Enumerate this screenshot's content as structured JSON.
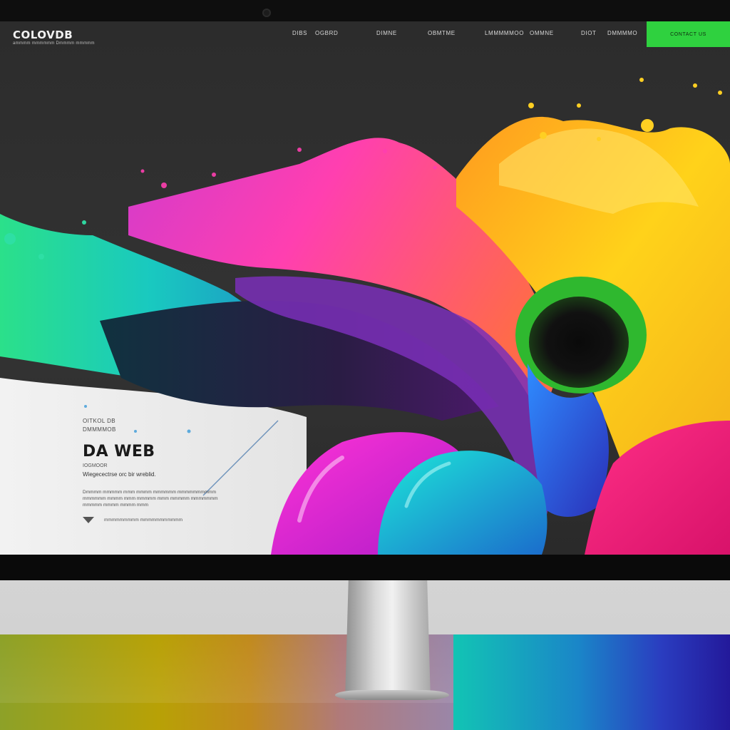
{
  "site": {
    "logo": "COLOVDB",
    "logo_sub": "ammmm mmmmmm Dmmmm mmmmm"
  },
  "nav": {
    "items": [
      "DIBS",
      "OGBRD",
      "DIMNE",
      "OBMTME",
      "LMMMMMOO",
      "OMMNE",
      "DIOT",
      "DMMMMO"
    ],
    "cta_label": "CONTACT US"
  },
  "hero": {
    "eyebrow1": "OITKOL DB",
    "eyebrow2": "DMMMMOB",
    "title": "DA WEB",
    "tag": "IOGMOOR",
    "lead": "Wiegecectrse orc bir wreblid.",
    "body": "Dmmmm mmmmm mmm mmmm mmmmmm mmmmmmmmmm mmmmmm mmmm mmm mmmmm mmm mmmmm mmmmmmm mmmmm mmmm mmmm mmm",
    "link": "mmmmmmmmm mmmmmmmmmmm"
  },
  "colors": {
    "cta": "#2fd13f",
    "screen_bg": "#2b2b2b",
    "hero_light": "#ececec"
  }
}
